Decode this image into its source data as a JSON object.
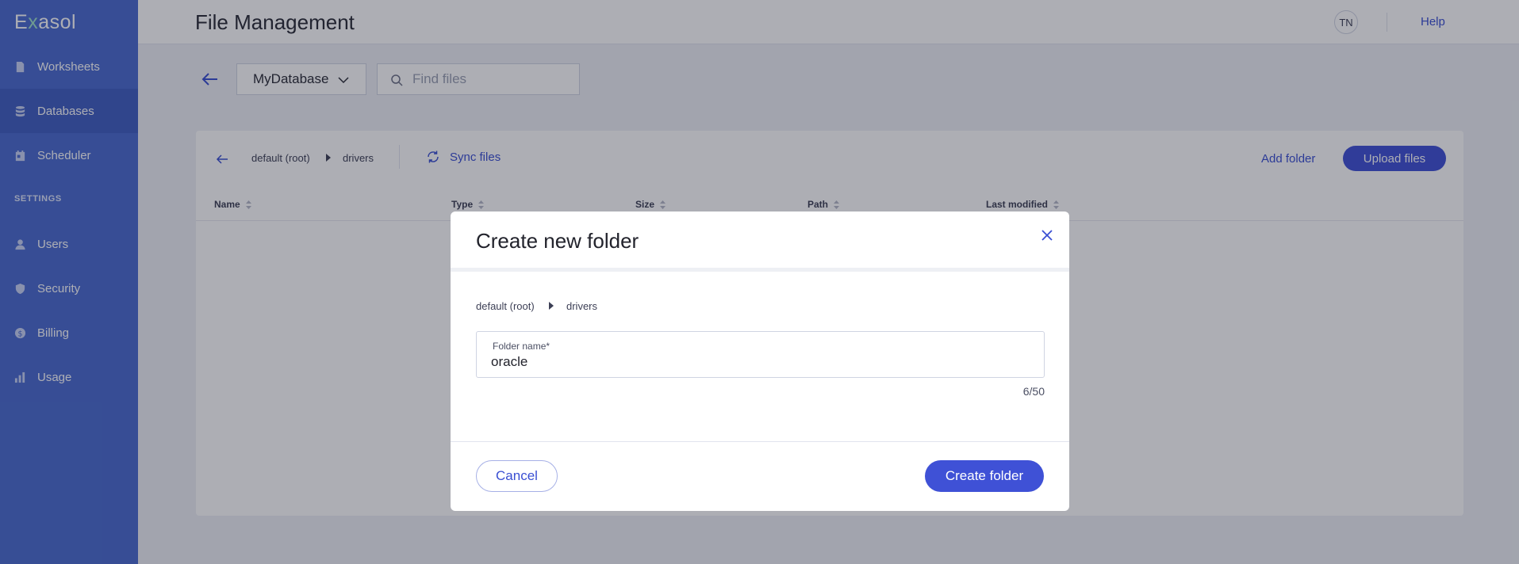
{
  "app": {
    "logo_prefix": "E",
    "logo_x": "x",
    "logo_suffix": "asol"
  },
  "sidebar": {
    "items": [
      {
        "label": "Worksheets",
        "icon": "file-icon"
      },
      {
        "label": "Databases",
        "icon": "database-icon",
        "active": true
      },
      {
        "label": "Scheduler",
        "icon": "calendar-icon"
      },
      {
        "label": "Users",
        "icon": "user-icon"
      },
      {
        "label": "Security",
        "icon": "shield-icon"
      },
      {
        "label": "Billing",
        "icon": "dollar-icon"
      },
      {
        "label": "Usage",
        "icon": "bar-chart-icon"
      }
    ],
    "section_settings": "SETTINGS"
  },
  "header": {
    "title": "File Management",
    "avatar_initials": "TN",
    "help_label": "Help"
  },
  "controls": {
    "database_selected": "MyDatabase",
    "search_placeholder": "Find files"
  },
  "browser": {
    "breadcrumb": [
      "default (root)",
      "drivers"
    ],
    "sync_label": "Sync files",
    "add_folder_label": "Add folder",
    "upload_label": "Upload files",
    "columns": [
      "Name",
      "Type",
      "Size",
      "Path",
      "Last modified"
    ]
  },
  "modal": {
    "title": "Create new folder",
    "breadcrumb": [
      "default (root)",
      "drivers"
    ],
    "field_label": "Folder name*",
    "field_value": "oracle",
    "counter": "6/50",
    "cancel_label": "Cancel",
    "create_label": "Create folder"
  },
  "colors": {
    "sidebar": "#4a6bd0",
    "accent": "#3f51d6",
    "link": "#3a4fd3"
  }
}
